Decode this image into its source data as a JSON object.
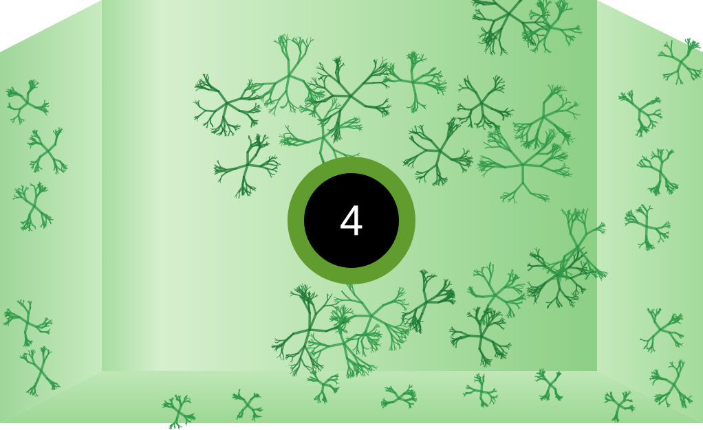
{
  "scene": {
    "type": "3d-room",
    "wall_texture": "green-fractal-pattern",
    "colors": {
      "wall_light": "#dff2d8",
      "wall_mid": "#a8dca0",
      "wall_dark": "#7cc47a",
      "fractal": "#2f9a48",
      "fractal_dark": "#1f7a36",
      "badge_ring": "#609c2e",
      "badge_fill": "#000000",
      "badge_text": "#ffffff"
    }
  },
  "counter": {
    "value": "4"
  }
}
